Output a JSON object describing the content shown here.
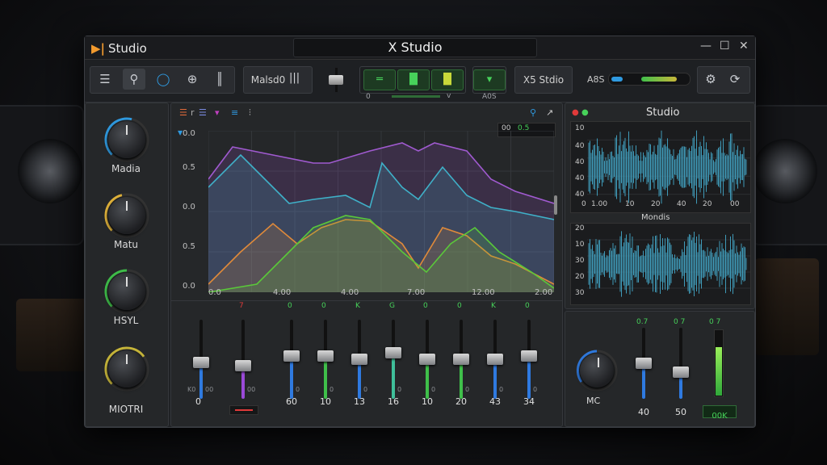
{
  "app": {
    "logo_text": "Studio",
    "window_title": "X Studio",
    "controls": {
      "minimize": "—",
      "maximize": "☐",
      "close": "✕"
    }
  },
  "toolbar": {
    "tool_icons": [
      "menu-icon",
      "magnify-icon",
      "circle-icon",
      "globe-icon",
      "waveform-icon"
    ],
    "group_label": "Malsd0",
    "group_label_icon": "bars-icon",
    "center_values": [
      "0",
      "",
      "v"
    ],
    "mode_label": "X5 Stdio",
    "mode_sublabel": "A0S",
    "abs_label": "A8S",
    "accent_green": "#47d25a",
    "accent_blue": "#2f9ae0"
  },
  "knobs": [
    {
      "label": "Madia",
      "color": "#2f9ae0",
      "level": 0.55
    },
    {
      "label": "Matu",
      "color": "#e0b23a",
      "level": 0.45
    },
    {
      "label": "HSYL",
      "color": "#3fbf4a",
      "level": 0.5
    },
    {
      "label": "MIOTRI",
      "color": "#c8b73a",
      "level": 0.7
    }
  ],
  "graph": {
    "readout": "00",
    "readout2": "0.5",
    "y_labels": [
      "0.0",
      "0.5",
      "0.0",
      "0.5",
      "0.0"
    ],
    "x_labels": [
      "0.0",
      "4.00",
      "4.00",
      "7.00",
      "12.00",
      "2.00"
    ],
    "series_colors": [
      "#a05ad0",
      "#3fb0c8",
      "#e08a3a",
      "#5ac83a"
    ]
  },
  "faders": [
    {
      "top": "",
      "bottom": "0",
      "color": "#2f7ae0",
      "level": 0.45,
      "ticks": [
        "K0",
        "00"
      ]
    },
    {
      "top": "7",
      "bottom": "",
      "color": "#9a4ad8",
      "level": 0.4,
      "ticks": [
        "",
        "00"
      ]
    },
    {
      "top": "0",
      "bottom": "60",
      "color": "#2f7ae0",
      "level": 0.55,
      "ticks": [
        "",
        "0"
      ]
    },
    {
      "top": "0",
      "bottom": "10",
      "color": "#3fbf4a",
      "level": 0.55,
      "ticks": [
        "",
        "0"
      ]
    },
    {
      "top": "K",
      "bottom": "13",
      "color": "#2f7ae0",
      "level": 0.5,
      "ticks": [
        "",
        "0"
      ]
    },
    {
      "top": "G",
      "bottom": "16",
      "color": "#3fbf9a",
      "level": 0.6,
      "ticks": [
        "",
        "0"
      ]
    },
    {
      "top": "0",
      "bottom": "10",
      "color": "#3fbf4a",
      "level": 0.5,
      "ticks": [
        "",
        "0"
      ]
    },
    {
      "top": "0",
      "bottom": "20",
      "color": "#3fbf4a",
      "level": 0.5,
      "ticks": [
        "",
        "0"
      ]
    },
    {
      "top": "K",
      "bottom": "43",
      "color": "#2f7ae0",
      "level": 0.5,
      "ticks": [
        "",
        "0"
      ]
    },
    {
      "top": "0",
      "bottom": "34",
      "color": "#2f7ae0",
      "level": 0.55,
      "ticks": [
        "",
        "0"
      ]
    }
  ],
  "right_panel": {
    "title": "Studio",
    "wave1_y": [
      "10",
      "40",
      "40",
      "40",
      "40"
    ],
    "wave1_x": [
      "0",
      "1.00",
      "10",
      "20",
      "40",
      "20",
      "00"
    ],
    "wave2_title": "Mondis",
    "wave2_y": [
      "20",
      "10",
      "30",
      "20",
      "30"
    ],
    "wave_color": "#3f9ab8",
    "knob_label": "MC",
    "faders": [
      {
        "top": "0.7",
        "bottom": "40",
        "color": "#2f7ae0",
        "level": 0.5
      },
      {
        "top": "0 7",
        "bottom": "50",
        "color": "#2f7ae0",
        "level": 0.35
      }
    ],
    "meter_top": "0 7",
    "meter_label": "00K",
    "meter_level": 0.75
  }
}
